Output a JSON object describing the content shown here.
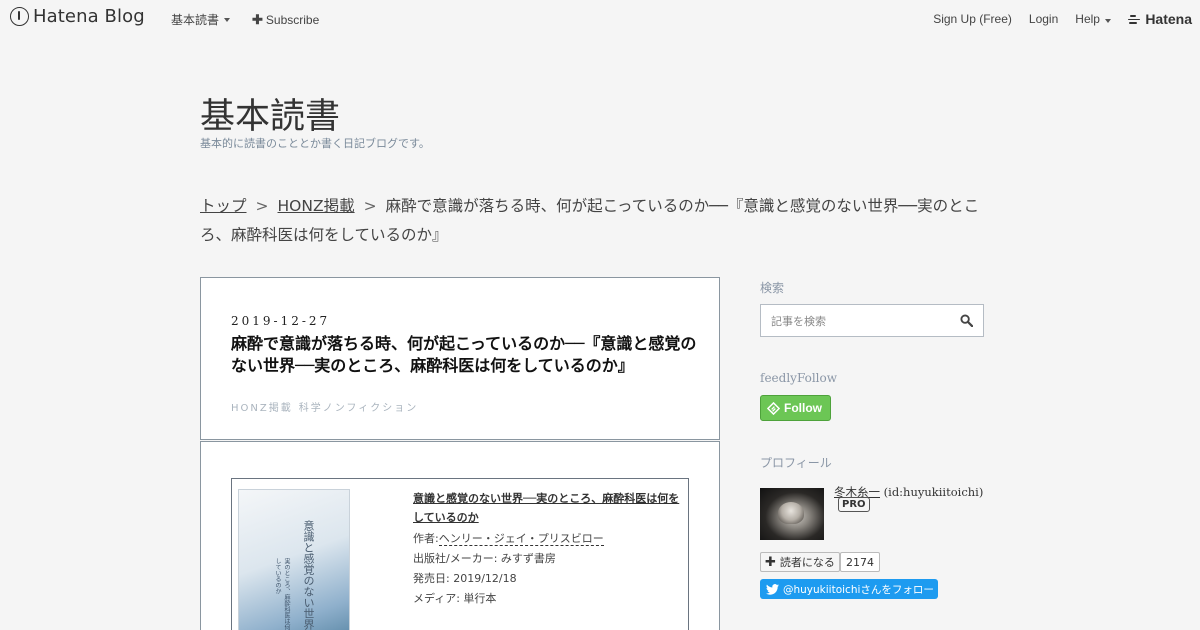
{
  "globalheader": {
    "logo_text": "Hatena Blog",
    "menu": [
      {
        "label": "基本読書"
      },
      {
        "label": "Subscribe"
      }
    ],
    "right": [
      {
        "label": "Sign Up (Free)"
      },
      {
        "label": "Login"
      },
      {
        "label": "Help"
      }
    ],
    "hatena_label": "Hatena"
  },
  "blog": {
    "title": "基本読書",
    "description": "基本的に読書のこととか書く日記ブログです。"
  },
  "breadcrumb": {
    "items": [
      "トップ",
      "HONZ掲載"
    ],
    "separator": ">",
    "current": "麻酔で意識が落ちる時、何が起こっているのか──『意識と感覚のない世界──実のところ、麻酔科医は何をしているのか』"
  },
  "entry": {
    "date": "2019-12-27",
    "title": "麻酔で意識が落ちる時、何が起こっているのか──『意識と感覚のない世界──実のところ、麻酔科医は何をしているのか』",
    "categories": [
      "HONZ掲載",
      "科学ノンフィクション"
    ]
  },
  "product": {
    "title": "意識と感覚のない世界──実のところ、麻酔科医は何をしているのか",
    "author_label": "作者:",
    "author": "ヘンリー・ジェイ・プリスビロー",
    "publisher": "出版社/メーカー: みすず書房",
    "release": "発売日: 2019/12/18",
    "media": "メディア: 単行本",
    "cover": {
      "title": "意識と感覚のない世界",
      "subtitle": "実のところ、麻酔科医は何をしているのか"
    }
  },
  "sidebar": {
    "search_heading": "検索",
    "search_placeholder": "記事を検索",
    "feedly_heading": "feedlyFollow",
    "follow_label": "Follow",
    "profile_heading": "プロフィール",
    "profile_name": "冬木糸一",
    "profile_id": "(id:huyukiitoichi)",
    "pro_badge": "PRO",
    "subscribe_label": "読者になる",
    "subscribe_count": "2174",
    "twitter_label": "@huyukiitoichiさんをフォロー"
  },
  "colors": {
    "follow_green": "#6cc655",
    "twitter_blue": "#1d9bf0",
    "sidebar_heading": "#8a96a6"
  },
  "icons": [
    "hatena-blog-logo-icon",
    "caret-down-icon",
    "plus-icon",
    "hatena-logo-icon",
    "search-icon",
    "feedly-icon",
    "plus-icon",
    "twitter-icon"
  ]
}
